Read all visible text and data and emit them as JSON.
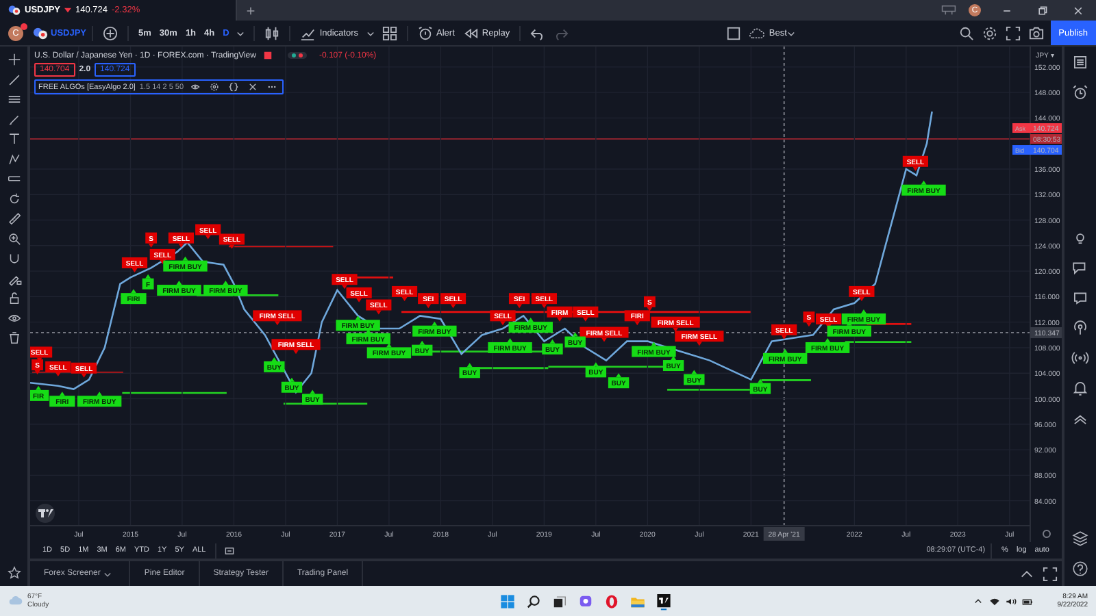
{
  "tab": {
    "symbol": "USDJPY",
    "price": "140.724",
    "change": "-2.32%"
  },
  "account_initial": "C",
  "toolbar": {
    "avatar_initial": "C",
    "symbol": "USDJPY",
    "timeframes": [
      {
        "label": "5m",
        "selected": false
      },
      {
        "label": "30m",
        "selected": false
      },
      {
        "label": "1h",
        "selected": false
      },
      {
        "label": "4h",
        "selected": false
      },
      {
        "label": "D",
        "selected": true
      }
    ],
    "indicators": "Indicators",
    "alert": "Alert",
    "replay": "Replay",
    "quality": "Best",
    "publish": "Publish"
  },
  "legend": {
    "title": "U.S. Dollar / Japanese Yen · 1D · FOREX.com · TradingView",
    "change": "-0.107 (-0.10%)",
    "bid": "140.704",
    "spread": "2.0",
    "ask": "140.724",
    "indicator": {
      "name": "FREE ALGOs [EasyAlgo 2.0]",
      "params": "1.5 14 2 5 50"
    }
  },
  "chart": {
    "currency": "JPY ▾",
    "price_tags": [
      {
        "kind": "ask",
        "label": "Ask",
        "value": "140.724"
      },
      {
        "kind": "timer",
        "value": "08:30:53"
      },
      {
        "kind": "bid",
        "label": "Bid",
        "value": "140.704"
      }
    ],
    "crosshair": {
      "date": "28 Apr '21",
      "price": "110.347"
    },
    "signals": [
      {
        "kind": "sell",
        "text": "SELL"
      },
      {
        "kind": "sell",
        "text": "S"
      },
      {
        "kind": "sell",
        "text": "SELL"
      },
      {
        "kind": "sell",
        "text": "SELL"
      },
      {
        "kind": "sell",
        "text": "SELL"
      },
      {
        "kind": "sell",
        "text": "S"
      },
      {
        "kind": "sell",
        "text": "SELL"
      },
      {
        "kind": "sell",
        "text": "SELL"
      },
      {
        "kind": "sell",
        "text": "SELL"
      },
      {
        "kind": "sell",
        "text": "SELL"
      },
      {
        "kind": "sell",
        "text": "FIRM SELL"
      },
      {
        "kind": "sell",
        "text": "FIRM SELL"
      },
      {
        "kind": "sell",
        "text": "SELL"
      },
      {
        "kind": "sell",
        "text": "SELL"
      },
      {
        "kind": "sell",
        "text": "SELL"
      },
      {
        "kind": "sell",
        "text": "SELL"
      },
      {
        "kind": "sell",
        "text": "SEI"
      },
      {
        "kind": "sell",
        "text": "SELL"
      },
      {
        "kind": "sell",
        "text": "SELL"
      },
      {
        "kind": "sell",
        "text": "SEI"
      },
      {
        "kind": "sell",
        "text": "SELL"
      },
      {
        "kind": "sell",
        "text": "FIRM"
      },
      {
        "kind": "sell",
        "text": "SELL"
      },
      {
        "kind": "sell",
        "text": "FIRM SELL"
      },
      {
        "kind": "sell",
        "text": "FIRI"
      },
      {
        "kind": "sell",
        "text": "S"
      },
      {
        "kind": "sell",
        "text": "FIRM SELL"
      },
      {
        "kind": "sell",
        "text": "FIRM SELL"
      },
      {
        "kind": "sell",
        "text": "SELL"
      },
      {
        "kind": "sell",
        "text": "S"
      },
      {
        "kind": "sell",
        "text": "SELL"
      },
      {
        "kind": "sell",
        "text": "SELL"
      },
      {
        "kind": "sell",
        "text": "SELL"
      },
      {
        "kind": "buy",
        "text": "FIR"
      },
      {
        "kind": "buy",
        "text": "FIRI"
      },
      {
        "kind": "buy",
        "text": "FIRM BUY"
      },
      {
        "kind": "buy",
        "text": "FIRI"
      },
      {
        "kind": "buy",
        "text": "F"
      },
      {
        "kind": "buy",
        "text": "FIRM BUY"
      },
      {
        "kind": "buy",
        "text": "FIRM BUY"
      },
      {
        "kind": "buy",
        "text": "FIRM BUY"
      },
      {
        "kind": "buy",
        "text": "BUY"
      },
      {
        "kind": "buy",
        "text": "BUY"
      },
      {
        "kind": "buy",
        "text": "BUY"
      },
      {
        "kind": "buy",
        "text": "FIRM BUY"
      },
      {
        "kind": "buy",
        "text": "FIRM BUY"
      },
      {
        "kind": "buy",
        "text": "FIRM BUY"
      },
      {
        "kind": "buy",
        "text": "BUY"
      },
      {
        "kind": "buy",
        "text": "FIRM BUY"
      },
      {
        "kind": "buy",
        "text": "BUY"
      },
      {
        "kind": "buy",
        "text": "FIRM BUY"
      },
      {
        "kind": "buy",
        "text": "FIRM BUY"
      },
      {
        "kind": "buy",
        "text": "BUY"
      },
      {
        "kind": "buy",
        "text": "BUY"
      },
      {
        "kind": "buy",
        "text": "BUY"
      },
      {
        "kind": "buy",
        "text": "BUY"
      },
      {
        "kind": "buy",
        "text": "FIRM BUY"
      },
      {
        "kind": "buy",
        "text": "BUY"
      },
      {
        "kind": "buy",
        "text": "BUY"
      },
      {
        "kind": "buy",
        "text": "BUY"
      },
      {
        "kind": "buy",
        "text": "FIRM BUY"
      },
      {
        "kind": "buy",
        "text": "FIRM BUY"
      },
      {
        "kind": "buy",
        "text": "FIRM BUY"
      },
      {
        "kind": "buy",
        "text": "FIRM BUY"
      },
      {
        "kind": "buy",
        "text": "FIRM BUY"
      }
    ],
    "chart_data": {
      "type": "line",
      "grid": true,
      "x": [
        2014.03,
        2014.3,
        2014.45,
        2014.6,
        2014.75,
        2014.9,
        2015.0,
        2015.2,
        2015.45,
        2015.55,
        2015.7,
        2015.9,
        2016.0,
        2016.1,
        2016.3,
        2016.5,
        2016.6,
        2016.75,
        2016.85,
        2017.0,
        2017.2,
        2017.4,
        2017.6,
        2017.8,
        2018.0,
        2018.2,
        2018.4,
        2018.6,
        2018.8,
        2019.0,
        2019.2,
        2019.4,
        2019.6,
        2019.8,
        2020.0,
        2020.2,
        2020.4,
        2020.6,
        2020.8,
        2021.0,
        2021.2,
        2021.4,
        2021.6,
        2021.8,
        2022.0,
        2022.2,
        2022.3,
        2022.4,
        2022.5,
        2022.6,
        2022.7,
        2022.75
      ],
      "series": [
        {
          "color": "#6fa8dc",
          "values": [
            102.5,
            102.0,
            101.5,
            103.0,
            108.0,
            118.0,
            119.0,
            120.5,
            123.0,
            124.5,
            121.5,
            121.0,
            118.0,
            114.0,
            110.0,
            104.0,
            101.0,
            104.0,
            112.0,
            117.0,
            113.0,
            111.0,
            111.0,
            113.0,
            112.5,
            107.0,
            110.0,
            111.0,
            113.0,
            109.0,
            111.0,
            108.0,
            106.0,
            109.0,
            109.0,
            108.0,
            107.0,
            106.0,
            104.5,
            103.0,
            109.0,
            109.5,
            110.0,
            114.0,
            115.0,
            118.0,
            124.0,
            130.0,
            136.0,
            135.0,
            140.0,
            145.0
          ]
        }
      ],
      "xlim": [
        2014.03,
        2023.7
      ],
      "ylim": [
        80.1,
        155.2
      ],
      "xticks": [
        {
          "value": 2014.5,
          "label": "Jul"
        },
        {
          "value": 2015,
          "label": "2015"
        },
        {
          "value": 2015.5,
          "label": "Jul"
        },
        {
          "value": 2016,
          "label": "2016"
        },
        {
          "value": 2016.5,
          "label": "Jul"
        },
        {
          "value": 2017,
          "label": "2017"
        },
        {
          "value": 2017.5,
          "label": "Jul"
        },
        {
          "value": 2018,
          "label": "2018"
        },
        {
          "value": 2018.5,
          "label": "Jul"
        },
        {
          "value": 2019,
          "label": "2019"
        },
        {
          "value": 2019.5,
          "label": "Jul"
        },
        {
          "value": 2020,
          "label": "2020"
        },
        {
          "value": 2020.5,
          "label": "Jul"
        },
        {
          "value": 2021,
          "label": "2021"
        },
        {
          "value": 2022,
          "label": "2022"
        },
        {
          "value": 2022.5,
          "label": "Jul"
        },
        {
          "value": 2023,
          "label": "2023"
        },
        {
          "value": 2023.5,
          "label": "Jul"
        }
      ],
      "yticks": [
        {
          "value": 84,
          "label": "84.000"
        },
        {
          "value": 88,
          "label": "88.000"
        },
        {
          "value": 92,
          "label": "92.000"
        },
        {
          "value": 96,
          "label": "96.000"
        },
        {
          "value": 100,
          "label": "100.000"
        },
        {
          "value": 104,
          "label": "104.000"
        },
        {
          "value": 108,
          "label": "108.000"
        },
        {
          "value": 112,
          "label": "112.000"
        },
        {
          "value": 116,
          "label": "116.000"
        },
        {
          "value": 120,
          "label": "120.000"
        },
        {
          "value": 124,
          "label": "124.000"
        },
        {
          "value": 128,
          "label": "128.000"
        },
        {
          "value": 132,
          "label": "132.000"
        },
        {
          "value": 136,
          "label": "136.000"
        },
        {
          "value": 144,
          "label": "144.000"
        },
        {
          "value": 148,
          "label": "148.000"
        },
        {
          "value": 152,
          "label": "152.000"
        }
      ]
    }
  },
  "range_bar": {
    "ranges": [
      "1D",
      "5D",
      "1M",
      "3M",
      "6M",
      "YTD",
      "1Y",
      "5Y",
      "ALL"
    ],
    "time": "08:29:07 (UTC-4)",
    "scale_options": [
      "%",
      "log",
      "auto"
    ]
  },
  "panels": [
    "Forex Screener",
    "Pine Editor",
    "Strategy Tester",
    "Trading Panel"
  ],
  "taskbar": {
    "temperature": "67°F",
    "condition": "Cloudy",
    "time": "8:29 AM",
    "date": "9/22/2022"
  }
}
